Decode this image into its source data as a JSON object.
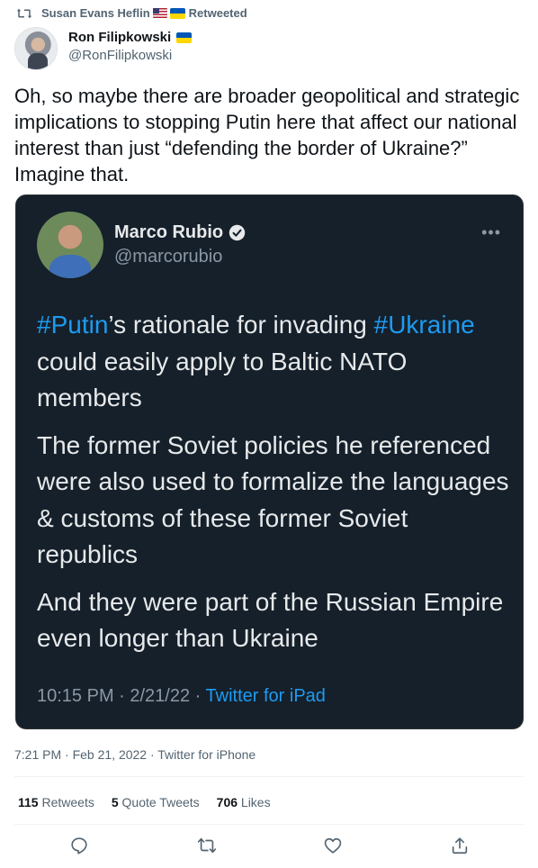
{
  "retweet": {
    "user": "Susan Evans Heflin",
    "label": "Retweeted"
  },
  "author": {
    "name": "Ron Filipkowski",
    "handle": "@RonFilipkowski"
  },
  "tweet": {
    "text": "Oh, so maybe there are broader geopolitical and strategic implications to stopping Putin here that affect our national interest than just “defending the border of Ukraine?” Imagine that."
  },
  "quoted": {
    "name": "Marco Rubio",
    "handle": "@marcorubio",
    "more": "•••",
    "p1": {
      "tag1": "#Putin",
      "text1": "’s rationale for invading ",
      "tag2": "#Ukraine",
      "text2": " could easily apply to Baltic NATO members"
    },
    "p2": "The former Soviet policies he referenced were also used to formalize the languages & customs of these former Soviet republics",
    "p3": "And they were part of the Russian Empire even longer than Ukraine",
    "time": "10:15 PM · 2/21/22 · ",
    "source": "Twitter for iPad"
  },
  "meta": {
    "text": "7:21 PM · Feb 21, 2022 · Twitter for iPhone"
  },
  "stats": {
    "retweets_count": "115",
    "retweets_label": " Retweets",
    "quotes_count": "5",
    "quotes_label": " Quote Tweets",
    "likes_count": "706",
    "likes_label": " Likes"
  },
  "icons": {
    "retweet": "retweet-icon",
    "reply": "reply-icon",
    "like": "heart-icon",
    "share": "share-icon",
    "verified": "verified-badge-icon"
  },
  "colors": {
    "accent": "#1d9bf0",
    "card_bg": "#15202b",
    "muted": "#536471"
  }
}
